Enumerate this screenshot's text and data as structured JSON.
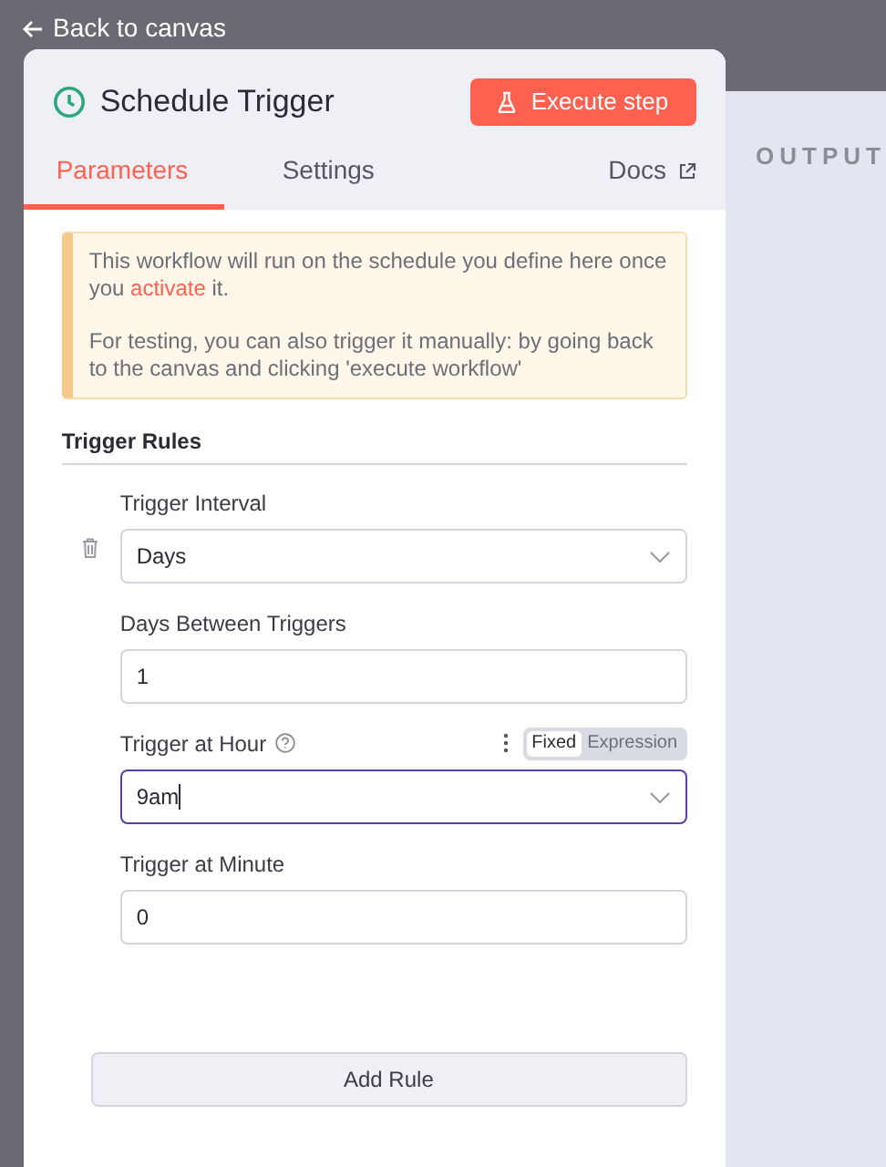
{
  "back_link": "Back to canvas",
  "node": {
    "title": "Schedule Trigger",
    "execute_button": "Execute step"
  },
  "tabs": [
    {
      "label": "Parameters",
      "selected": true
    },
    {
      "label": "Settings",
      "selected": false
    }
  ],
  "docs_link": "Docs",
  "notice": {
    "before": "This workflow will run on the schedule you define here once you ",
    "link": "activate",
    "after": " it.",
    "second": "For testing, you can also trigger it manually: by going back to the canvas and clicking 'execute workflow'"
  },
  "section_title": "Trigger Rules",
  "fields": [
    {
      "label": "Trigger Interval",
      "kind": "select",
      "value": "Days",
      "focused": false
    },
    {
      "label": "Days Between Triggers",
      "kind": "input",
      "value": "1",
      "focused": false
    },
    {
      "label": "Trigger at Hour",
      "kind": "select",
      "value": "9am",
      "focused": true,
      "help": true,
      "modes": [
        {
          "label": "Fixed",
          "selected": true
        },
        {
          "label": "Expression",
          "selected": false
        }
      ]
    },
    {
      "label": "Trigger at Minute",
      "kind": "input",
      "value": "0",
      "focused": false
    }
  ],
  "add_rule_button": "Add Rule",
  "output_panel": {
    "title": "OUTPUT"
  }
}
